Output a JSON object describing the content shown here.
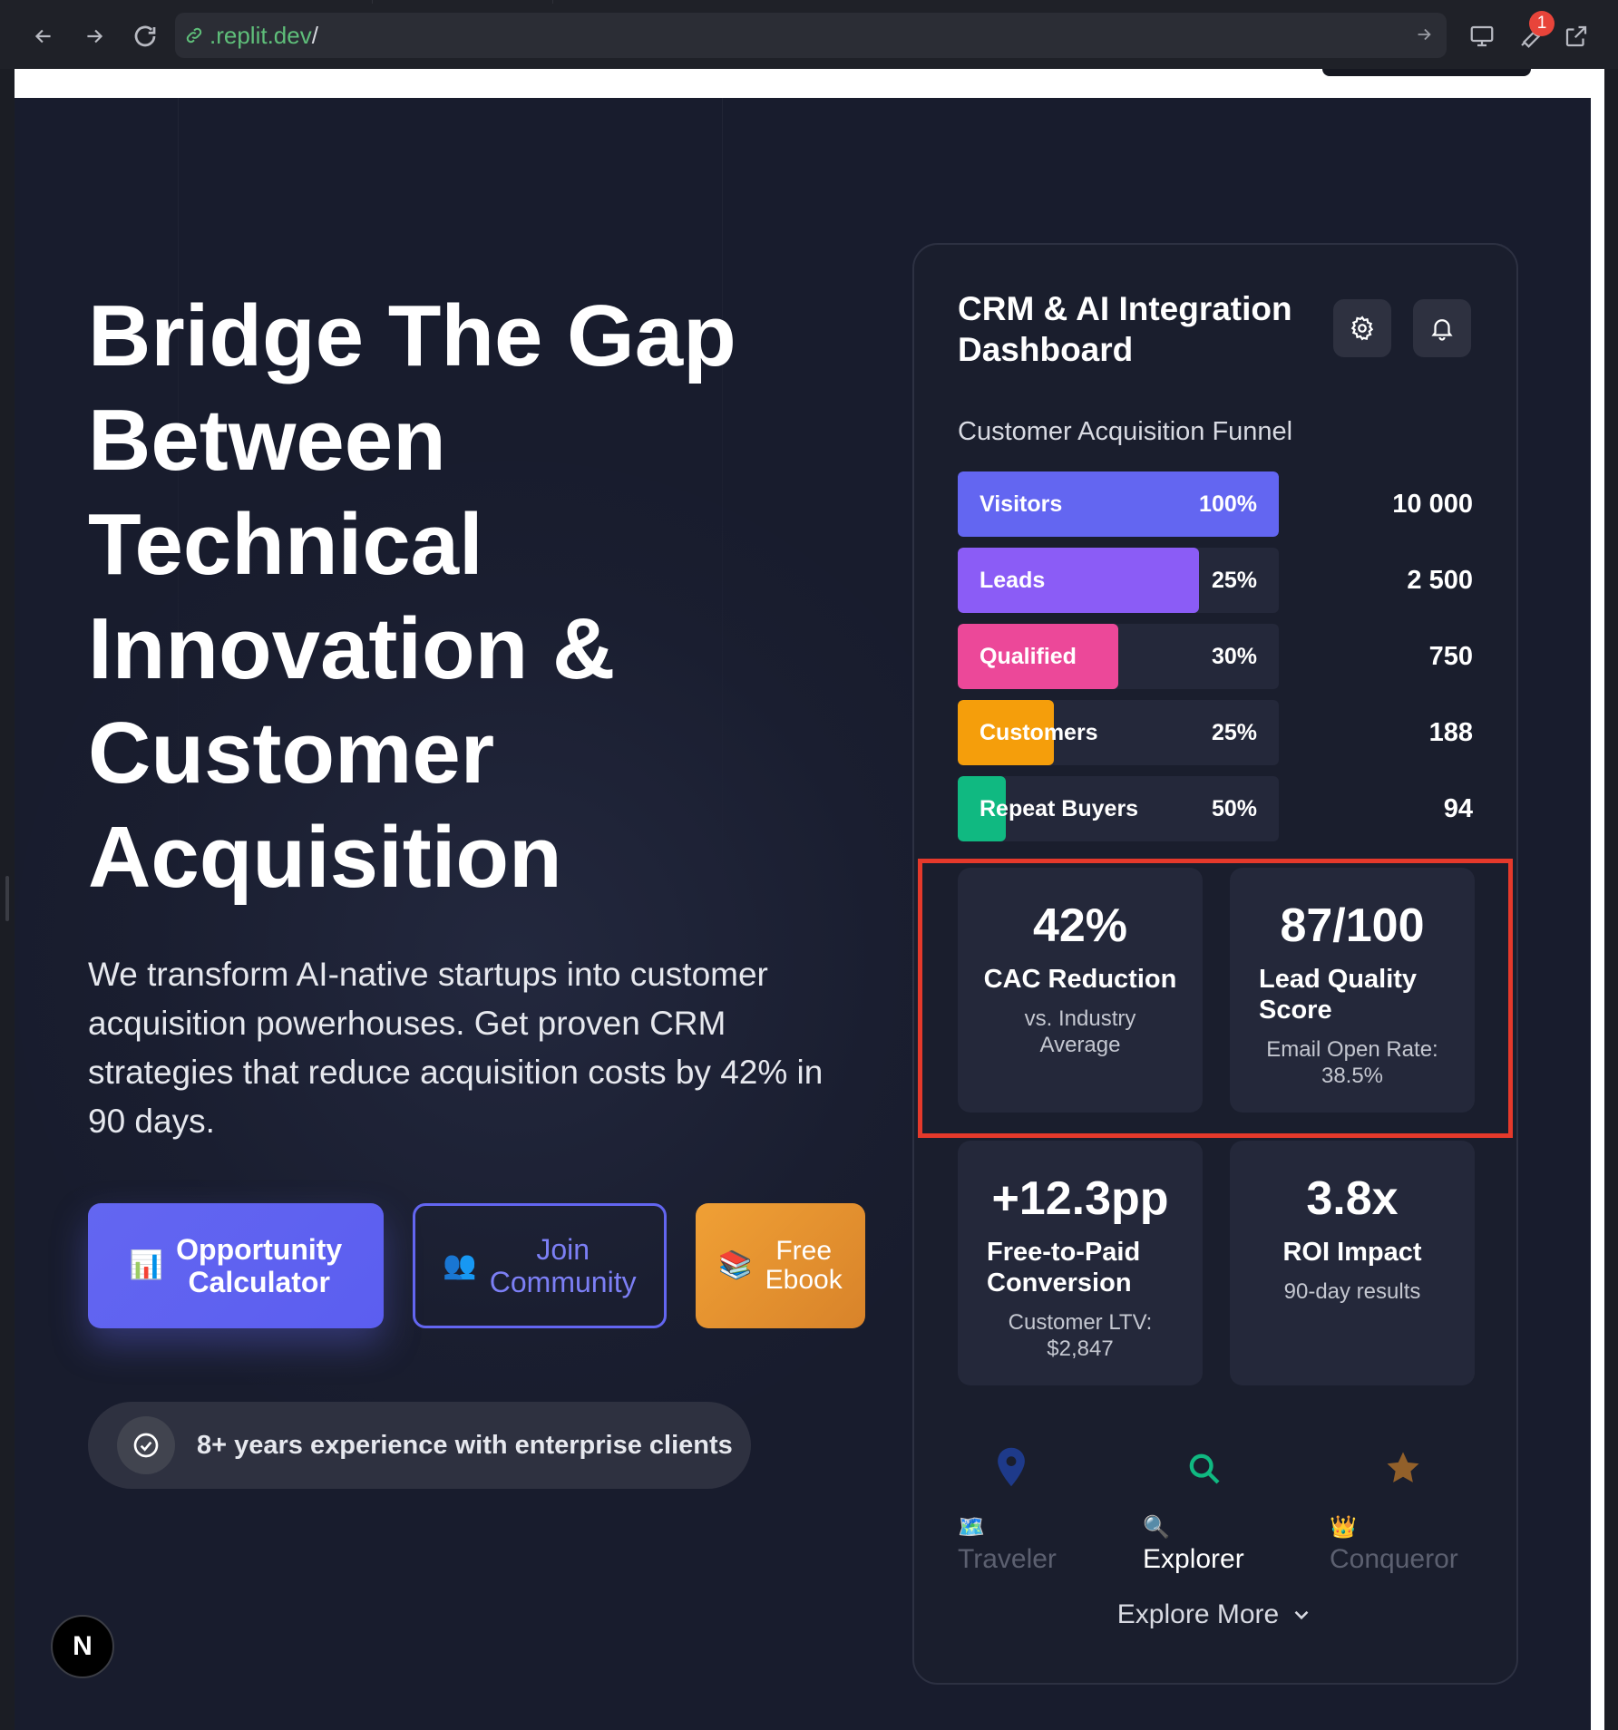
{
  "browser": {
    "url": ".replit.dev",
    "url_slash": "/",
    "notification_count": "1"
  },
  "hero": {
    "title_lines": [
      "Bridge The Gap",
      "Between",
      "Technical",
      "Innovation &",
      "Customer",
      "Acquisition"
    ],
    "subtitle": "We transform AI-native startups into customer acquisition powerhouses. Get proven CRM strategies that reduce acquisition costs by 42% in 90 days.",
    "buttons": {
      "calculator": {
        "emoji": "📊",
        "label_lines": [
          "Opportunity",
          "Calculator"
        ]
      },
      "community": {
        "emoji": "👥",
        "label_lines": [
          "Join",
          "Community"
        ]
      },
      "ebook": {
        "emoji": "📚",
        "label_lines": [
          "Free",
          "Ebook"
        ]
      }
    },
    "experience": "8+ years experience with enterprise clients"
  },
  "floating_button": {
    "label": "N"
  },
  "dashboard": {
    "title_lines": [
      "CRM & AI Integration",
      "Dashboard"
    ],
    "funnel_title": "Customer Acquisition Funnel",
    "funnel": [
      {
        "name": "Visitors",
        "pct": "100%",
        "count": "10 000",
        "fill_fraction": 1.0,
        "color": "#6366f1"
      },
      {
        "name": "Leads",
        "pct": "25%",
        "count": "2 500",
        "fill_fraction": 0.75,
        "color": "#8b5cf6"
      },
      {
        "name": "Qualified",
        "pct": "30%",
        "count": "750",
        "fill_fraction": 0.5,
        "color": "#ec4899"
      },
      {
        "name": "Customers",
        "pct": "25%",
        "count": "188",
        "fill_fraction": 0.3,
        "color": "#f59e0b"
      },
      {
        "name": "Repeat Buyers",
        "pct": "50%",
        "count": "94",
        "fill_fraction": 0.15,
        "color": "#10b981"
      }
    ],
    "metrics": [
      {
        "value": "42%",
        "label": "CAC Reduction",
        "sub": "vs. Industry Average"
      },
      {
        "value": "87/100",
        "label": "Lead Quality Score",
        "sub": "Email Open Rate: 38.5%"
      },
      {
        "value": "+12.3pp",
        "label": "Free-to-Paid Conversion",
        "sub": "Customer LTV: $2,847"
      },
      {
        "value": "3.8x",
        "label": "ROI Impact",
        "sub": "90-day results"
      }
    ],
    "levels": [
      {
        "name": "Traveler",
        "emoji": "🗺️",
        "icon": "map-pin-icon",
        "active": false
      },
      {
        "name": "Explorer",
        "emoji": "🔍",
        "icon": "search-icon",
        "active": true
      },
      {
        "name": "Conqueror",
        "emoji": "👑",
        "icon": "star-icon",
        "active": false
      }
    ],
    "explore_more": "Explore More"
  }
}
